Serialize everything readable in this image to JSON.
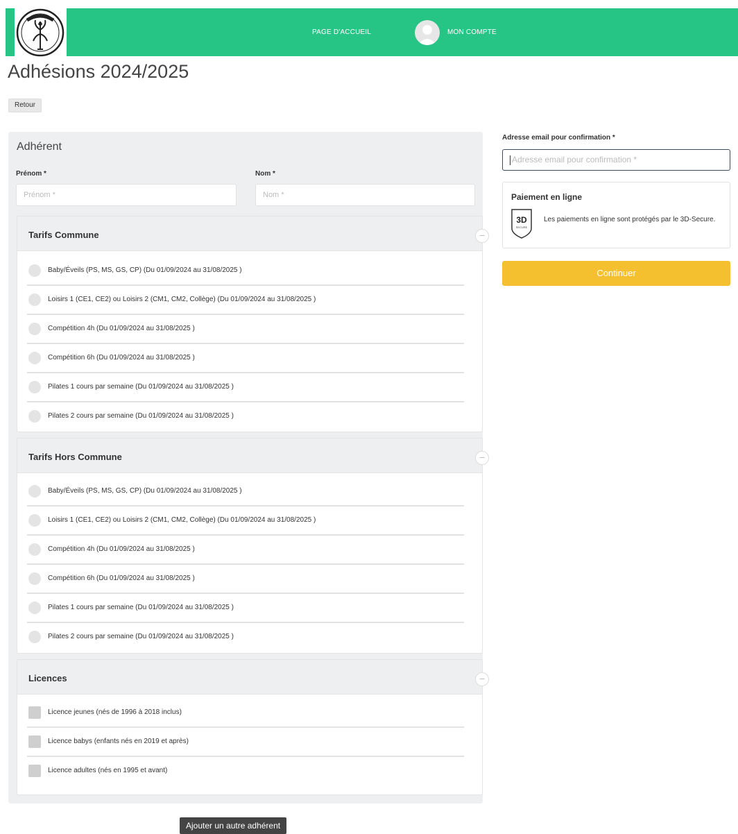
{
  "header": {
    "logo_text": "GR PARAY",
    "nav_home": "PAGE D'ACCUEIL",
    "nav_account": "MON COMPTE",
    "accent_color": "#26c485"
  },
  "page": {
    "title": "Adhésions 2024/2025",
    "back_button": "Retour"
  },
  "member": {
    "section_title": "Adhérent",
    "first_name_label": "Prénom *",
    "first_name_placeholder": "Prénom *",
    "last_name_label": "Nom *",
    "last_name_placeholder": "Nom *"
  },
  "tarifs_commune": {
    "title": "Tarifs Commune",
    "collapse_icon": "−",
    "options": [
      "Baby/Éveils (PS, MS, GS, CP) (Du 01/09/2024 au 31/08/2025 )",
      "Loisirs 1 (CE1, CE2) ou Loisirs 2 (CM1, CM2, Collège) (Du 01/09/2024 au 31/08/2025 )",
      "Compétition 4h (Du 01/09/2024 au 31/08/2025 )",
      "Compétition 6h (Du 01/09/2024 au 31/08/2025 )",
      "Pilates 1 cours par semaine (Du 01/09/2024 au 31/08/2025 )",
      "Pilates 2 cours par semaine (Du 01/09/2024 au 31/08/2025 )"
    ]
  },
  "tarifs_hors_commune": {
    "title": "Tarifs Hors Commune",
    "collapse_icon": "−",
    "options": [
      "Baby/Éveils (PS, MS, GS, CP) (Du 01/09/2024 au 31/08/2025 )",
      "Loisirs 1 (CE1, CE2) ou Loisirs 2 (CM1, CM2, Collège) (Du 01/09/2024 au 31/08/2025 )",
      "Compétition 4h (Du 01/09/2024 au 31/08/2025 )",
      "Compétition 6h (Du 01/09/2024 au 31/08/2025 )",
      "Pilates 1 cours par semaine (Du 01/09/2024 au 31/08/2025 )",
      "Pilates 2 cours par semaine (Du 01/09/2024 au 31/08/2025 )"
    ]
  },
  "licences": {
    "title": "Licences",
    "collapse_icon": "−",
    "options": [
      "Licence jeunes (nés de 1996 à 2018 inclus)",
      "Licence babys (enfants nés en 2019 et après)",
      "Licence adultes (nés en 1995 et avant)"
    ]
  },
  "add_member_button": "Ajouter un autre adhérent",
  "confirmation": {
    "email_label": "Adresse email pour confirmation *",
    "email_placeholder": "Adresse email pour confirmation *"
  },
  "payment": {
    "title": "Paiement en ligne",
    "secure_badge": "3D",
    "secure_badge_sub": "SECURE",
    "text": "Les paiements en ligne sont protégés par le 3D-Secure.",
    "continue_button": "Continuer",
    "button_color": "#f5c02f"
  }
}
